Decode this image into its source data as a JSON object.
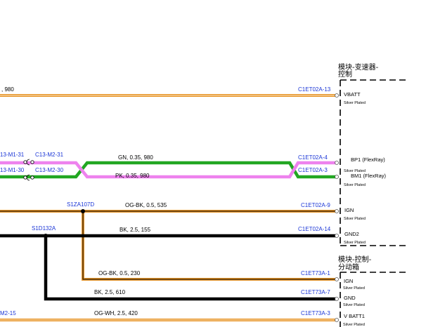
{
  "modules": {
    "tcm": {
      "line1": "模块-变速器-",
      "line2": "控制"
    },
    "tcu": {
      "line1": "模块-控制-",
      "line2": "分动箱"
    }
  },
  "wires": {
    "vbatt_left": ", 980",
    "gn": "GN, 0.35, 980",
    "pk": "PK, 0.35, 980",
    "og_bk_535": "OG-BK, 0.5, 535",
    "bk_155": "BK, 2.5, 155",
    "og_bk_230": "OG-BK, 0.5, 230",
    "bk_610": "BK, 2.5, 610",
    "og_wh_420": "OG-WH, 2.5, 420"
  },
  "splices": {
    "s1": "S1ZA107D",
    "s2": "S1D132A"
  },
  "inline": {
    "m1_31": "13-M1-31",
    "m2_31": "C13-M2-31",
    "m1_30": "13-M1-30",
    "m2_30": "C13-M2-30",
    "left_bottom": "M2-15"
  },
  "connectors": {
    "c13": "C1ET02A-13",
    "c4": "C1ET02A-4",
    "c3": "C1ET02A-3",
    "c9": "C1ET02A-9",
    "c14": "C1ET02A-14",
    "d1": "C1ET73A-1",
    "d7": "C1ET73A-7",
    "d3": "C1ET73A-3"
  },
  "pins": {
    "vbatt": "VBATT",
    "bp1": "BP1 (FlexRay)",
    "bm1": "BM1 (FlexRay)",
    "ign": "IGN",
    "gnd2": "GND2",
    "ign2": "IGN",
    "gnd": "GND",
    "vbatt1": "V BATT1",
    "plating": "Silver Plated"
  },
  "colors": {
    "orange": "#e8962a",
    "green": "#22a722",
    "pink": "#ee82ee",
    "black": "#000000",
    "connector_text": "#1a35d6"
  }
}
